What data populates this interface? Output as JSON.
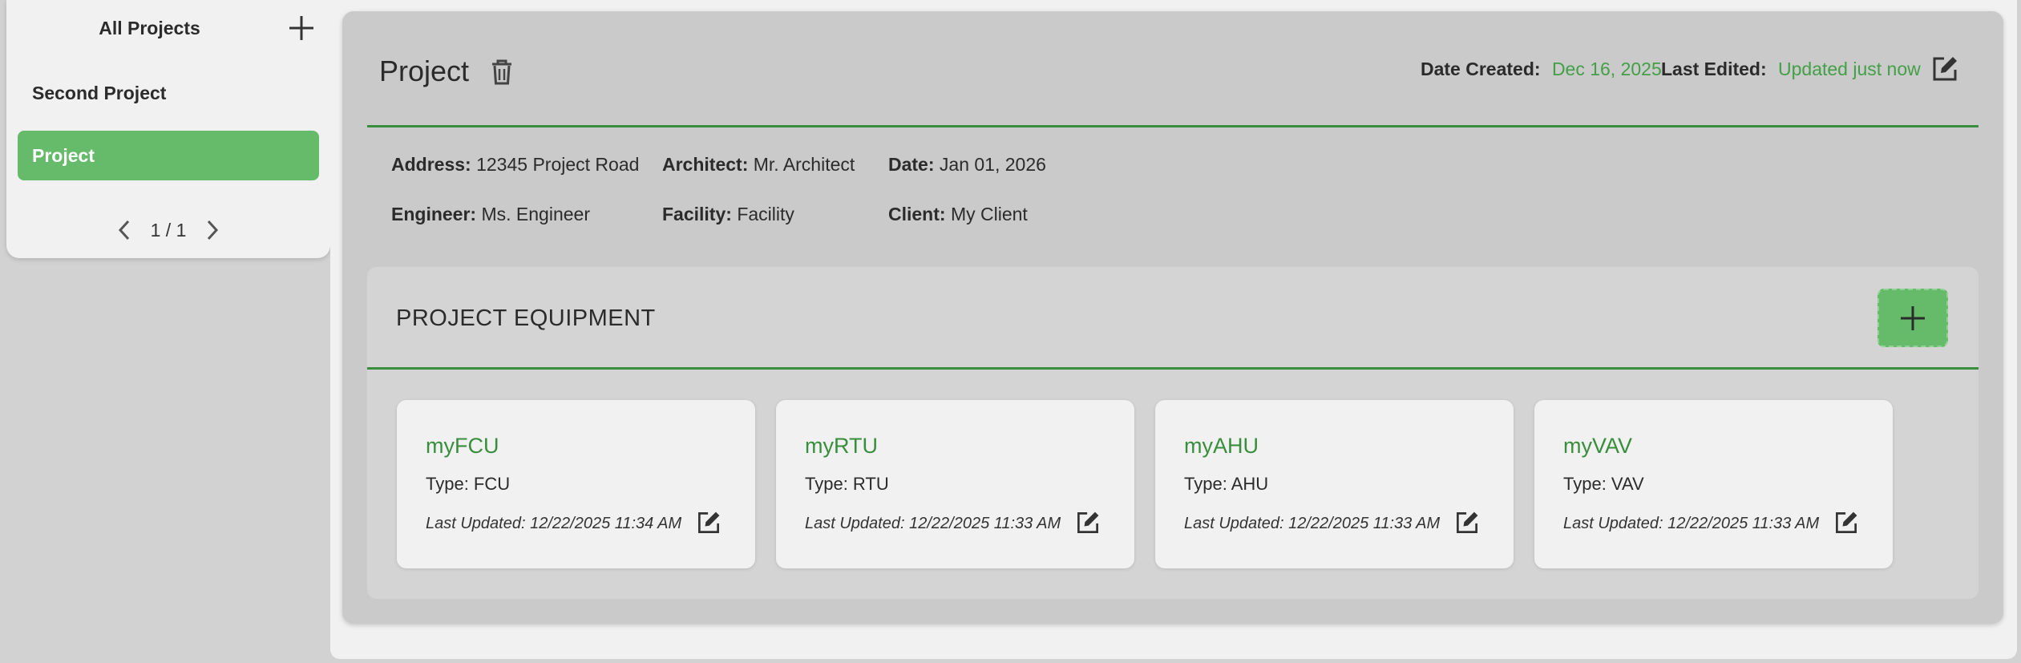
{
  "sidebar": {
    "title": "All Projects",
    "add_icon": "plus-icon",
    "items": [
      {
        "label": "Second Project",
        "active": false
      },
      {
        "label": "Project",
        "active": true
      }
    ],
    "pager": {
      "text": "1 / 1"
    }
  },
  "project": {
    "title": "Project",
    "date_created_label": "Date Created:",
    "date_created": "Dec 16, 2025",
    "last_edited_label": "Last Edited:",
    "last_edited": "Updated just now",
    "info": {
      "address_label": "Address:",
      "address": "12345 Project Road",
      "architect_label": "Architect:",
      "architect": "Mr. Architect",
      "date_label": "Date:",
      "date": "Jan 01, 2026",
      "engineer_label": "Engineer:",
      "engineer": "Ms. Engineer",
      "facility_label": "Facility:",
      "facility": "Facility",
      "client_label": "Client:",
      "client": "My Client"
    }
  },
  "equipment": {
    "title": "PROJECT EQUIPMENT",
    "cards": [
      {
        "name": "myFCU",
        "type": "Type: FCU",
        "updated": "Last Updated: 12/22/2025 11:34 AM"
      },
      {
        "name": "myRTU",
        "type": "Type: RTU",
        "updated": "Last Updated: 12/22/2025 11:33 AM"
      },
      {
        "name": "myAHU",
        "type": "Type: AHU",
        "updated": "Last Updated: 12/22/2025 11:33 AM"
      },
      {
        "name": "myVAV",
        "type": "Type: VAV",
        "updated": "Last Updated: 12/22/2025 11:33 AM"
      }
    ]
  },
  "colors": {
    "accent": "#66bb6a",
    "accent_dark": "#388e3c",
    "link_green": "#43a047"
  }
}
